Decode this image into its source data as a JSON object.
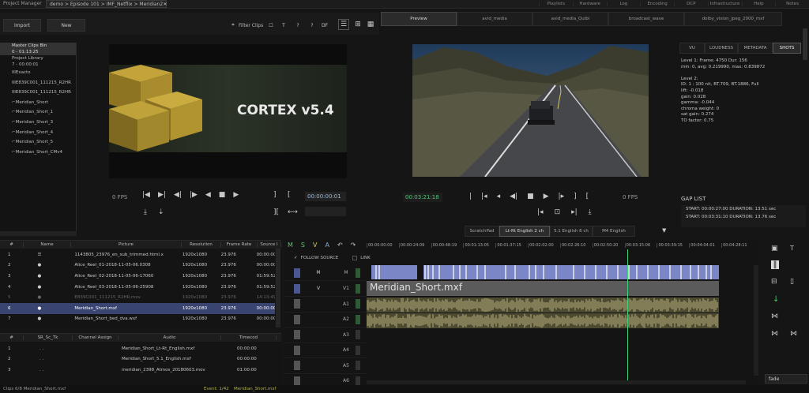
{
  "breadcrumb": {
    "app": "Project Manager",
    "path": "demo > Episode 101 > IMF_Netflix > Meridian2"
  },
  "topnav": [
    "Playlists",
    "Hardware",
    "Log",
    "Encoding",
    "DCP",
    "Infrastructure",
    "Help",
    "Notes"
  ],
  "toolbar": {
    "import": "Import",
    "new": "New",
    "filter": "Filter Clips"
  },
  "project_tree": [
    "Master Clips Bin",
    "0 - 01:13:25",
    "Project Library",
    "7 - 00:00:01",
    "IIIExacto",
    "IIIE839C001_111215_R2HR",
    "IIIE839C001_111215_R2HR",
    "⌐Meridian_Short",
    "⌐Meridian_Short_1",
    "⌐Meridian_Short_3",
    "⌐Meridian_Short_4",
    "⌐Meridian_Short_5",
    "⌐Meridian_Short_CMv4"
  ],
  "source": {
    "logo": "CORTEX v5.4",
    "fps": "0 FPS",
    "timecode": "00:00:00:01"
  },
  "preview_tabs": [
    "Preview",
    "avid_media",
    "avid_media_Quibi",
    "broadcast_wave",
    "dolby_vision_jpeg_2000_mxf"
  ],
  "record": {
    "timecode": "00:03:21:18",
    "fps": "0 FPS"
  },
  "audio_tabs": [
    "ScratchPad",
    "Lt-Rt English 2 ch",
    "5.1 English 6 ch",
    "M4 English"
  ],
  "info_tabs": [
    "VU",
    "LOUDNESS",
    "METADATA",
    "SHOTS"
  ],
  "info_text": [
    "Level 1:  Frame: 4750    Dur: 156",
    "min: 0, avg: 0.219990, max: 0.839872",
    "",
    "Level 2:",
    "ID: 1 : 100 nit, BT.709, BT.1886, Full",
    "lift: -0.018",
    "gain: 0.028",
    "gamma: -0.044",
    "chroma weight: 0",
    "sat gain: 0.274",
    "TO factor: 0.75"
  ],
  "gap_list": {
    "title": "GAP LIST",
    "items": [
      "START: 00:00:27:00 DURATION: 13.51 sec",
      "START: 00:03:31:10 DURATION: 13.76 sec"
    ]
  },
  "clip_table": {
    "headers": [
      "#",
      "Name",
      "Picture",
      "Resolution",
      "Frame Rate",
      "Source I"
    ],
    "rows": [
      {
        "n": "1",
        "icon": "☰",
        "pic": "1143805_23976_en_sub_trimmed.html.x",
        "res": "1920x1080",
        "fr": "23.976",
        "src": "00:00:00"
      },
      {
        "n": "2",
        "icon": "●",
        "pic": "Alice_Reel_01-2018-11-05-06.0308",
        "res": "1920x1080",
        "fr": "23.976",
        "src": "00:00:00"
      },
      {
        "n": "3",
        "icon": "●",
        "pic": "Alice_Reel_02-2018-11-05-06-17060",
        "res": "1920x1080",
        "fr": "23.976",
        "src": "01:59:52"
      },
      {
        "n": "4",
        "icon": "●",
        "pic": "Alice_Reel_03-2018-11-05-06-25908",
        "res": "1920x1080",
        "fr": "23.976",
        "src": "01:59:52"
      },
      {
        "n": "5",
        "icon": "●",
        "pic": "E839C001_111215_R2HR.mov",
        "res": "1920x1080",
        "fr": "23.976",
        "src": "14:13:49"
      },
      {
        "n": "6",
        "icon": "●",
        "pic": "Meridian_Short.mxf",
        "res": "1920x1080",
        "fr": "23.976",
        "src": "00:00:00"
      },
      {
        "n": "7",
        "icon": "●",
        "pic": "Meridian_Short_bed_dva.wxf",
        "res": "1920x1080",
        "fr": "23.976",
        "src": "00:00:00"
      }
    ]
  },
  "audio_table": {
    "headers": [
      "#",
      "SR_Sc_Tk",
      "Channel Assign",
      "Audio",
      "Timecod"
    ],
    "rows": [
      {
        "n": "1",
        "sr": ". .",
        "ch": "",
        "audio": "Meridian_Short_Lt-Rt_English.mxf",
        "tc": "00:00:00"
      },
      {
        "n": "2",
        "sr": ". .",
        "ch": "",
        "audio": "Meridian_Short_5.1_English.mxf",
        "tc": "00:00:00"
      },
      {
        "n": "3",
        "sr": ". .",
        "ch": "",
        "audio": "meridian_2398_Atmos_20180603.mov",
        "tc": "01:00:00"
      }
    ]
  },
  "timeline": {
    "ruler": [
      "00:00:00:00",
      "00:00:24:09",
      "00:00:48:19",
      "00:01:13:05",
      "00:01:37:15",
      "00:02:02:00",
      "00:02:26:10",
      "00:02:50:20",
      "00:03:15:06",
      "00:03:39:15",
      "00:04:04:01",
      "00:04:28:11"
    ],
    "follow_source": "FOLLOW SOURCE",
    "link": "LINK",
    "clip_label": "Meridian_Short.mxf",
    "tracks": [
      {
        "a": "M",
        "b": "M"
      },
      {
        "a": "V",
        "b": "V1"
      },
      {
        "a": "",
        "b": "A1"
      },
      {
        "a": "",
        "b": "A2"
      },
      {
        "a": "",
        "b": "A3"
      },
      {
        "a": "",
        "b": "A4"
      },
      {
        "a": "",
        "b": "A5"
      },
      {
        "a": "",
        "b": "A6"
      }
    ],
    "blend": "fade"
  },
  "status": {
    "clips": "Clips 6/8   Meridian_Short.mxf",
    "event": "Event: 1/42",
    "event_clip": "Meridian_Short.mxf"
  }
}
